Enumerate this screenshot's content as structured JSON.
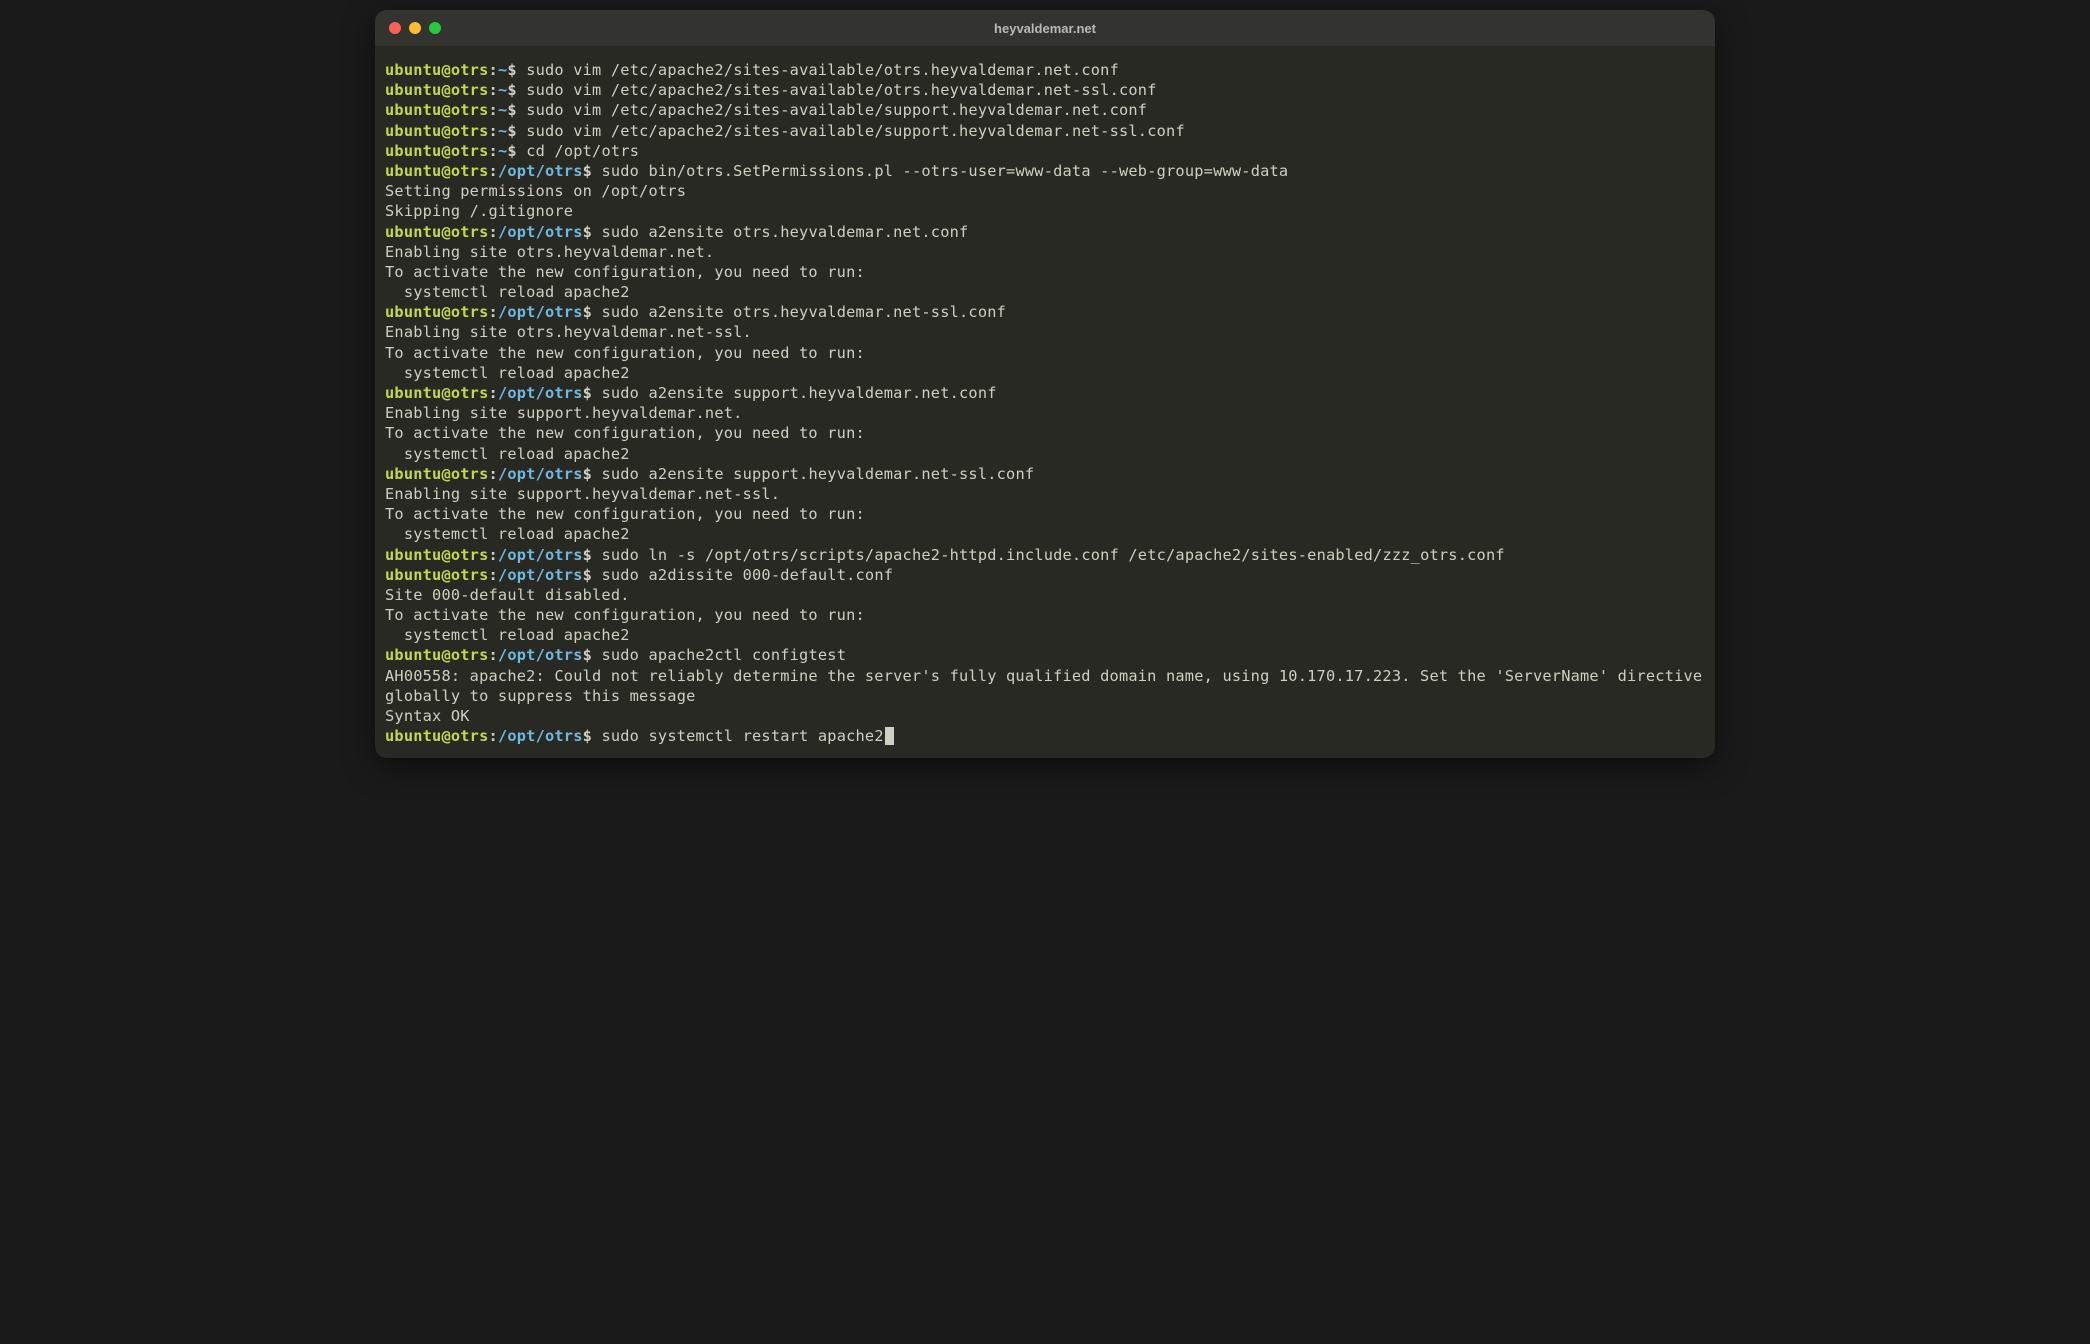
{
  "window": {
    "title": "heyvaldemar.net"
  },
  "colors": {
    "bg": "#282923",
    "titlebar": "#333430",
    "text": "#cfcfc2",
    "promptUser": "#c4d94a",
    "promptPath": "#6fb9e0",
    "red": "#ff5f56",
    "yellow": "#ffbd2e",
    "green": "#27c93f"
  },
  "lines": [
    {
      "type": "prompt",
      "user": "ubuntu@otrs",
      "path": "~",
      "cmd": "sudo vim /etc/apache2/sites-available/otrs.heyvaldemar.net.conf"
    },
    {
      "type": "prompt",
      "user": "ubuntu@otrs",
      "path": "~",
      "cmd": "sudo vim /etc/apache2/sites-available/otrs.heyvaldemar.net-ssl.conf"
    },
    {
      "type": "prompt",
      "user": "ubuntu@otrs",
      "path": "~",
      "cmd": "sudo vim /etc/apache2/sites-available/support.heyvaldemar.net.conf"
    },
    {
      "type": "prompt",
      "user": "ubuntu@otrs",
      "path": "~",
      "cmd": "sudo vim /etc/apache2/sites-available/support.heyvaldemar.net-ssl.conf"
    },
    {
      "type": "prompt",
      "user": "ubuntu@otrs",
      "path": "~",
      "cmd": "cd /opt/otrs"
    },
    {
      "type": "prompt",
      "user": "ubuntu@otrs",
      "path": "/opt/otrs",
      "cmd": "sudo bin/otrs.SetPermissions.pl --otrs-user=www-data --web-group=www-data"
    },
    {
      "type": "out",
      "text": "Setting permissions on /opt/otrs"
    },
    {
      "type": "out",
      "text": "Skipping /.gitignore"
    },
    {
      "type": "prompt",
      "user": "ubuntu@otrs",
      "path": "/opt/otrs",
      "cmd": "sudo a2ensite otrs.heyvaldemar.net.conf"
    },
    {
      "type": "out",
      "text": "Enabling site otrs.heyvaldemar.net."
    },
    {
      "type": "out",
      "text": "To activate the new configuration, you need to run:"
    },
    {
      "type": "out",
      "text": "  systemctl reload apache2"
    },
    {
      "type": "prompt",
      "user": "ubuntu@otrs",
      "path": "/opt/otrs",
      "cmd": "sudo a2ensite otrs.heyvaldemar.net-ssl.conf"
    },
    {
      "type": "out",
      "text": "Enabling site otrs.heyvaldemar.net-ssl."
    },
    {
      "type": "out",
      "text": "To activate the new configuration, you need to run:"
    },
    {
      "type": "out",
      "text": "  systemctl reload apache2"
    },
    {
      "type": "prompt",
      "user": "ubuntu@otrs",
      "path": "/opt/otrs",
      "cmd": "sudo a2ensite support.heyvaldemar.net.conf"
    },
    {
      "type": "out",
      "text": "Enabling site support.heyvaldemar.net."
    },
    {
      "type": "out",
      "text": "To activate the new configuration, you need to run:"
    },
    {
      "type": "out",
      "text": "  systemctl reload apache2"
    },
    {
      "type": "prompt",
      "user": "ubuntu@otrs",
      "path": "/opt/otrs",
      "cmd": "sudo a2ensite support.heyvaldemar.net-ssl.conf"
    },
    {
      "type": "out",
      "text": "Enabling site support.heyvaldemar.net-ssl."
    },
    {
      "type": "out",
      "text": "To activate the new configuration, you need to run:"
    },
    {
      "type": "out",
      "text": "  systemctl reload apache2"
    },
    {
      "type": "prompt",
      "user": "ubuntu@otrs",
      "path": "/opt/otrs",
      "cmd": "sudo ln -s /opt/otrs/scripts/apache2-httpd.include.conf /etc/apache2/sites-enabled/zzz_otrs.conf"
    },
    {
      "type": "prompt",
      "user": "ubuntu@otrs",
      "path": "/opt/otrs",
      "cmd": "sudo a2dissite 000-default.conf"
    },
    {
      "type": "out",
      "text": "Site 000-default disabled."
    },
    {
      "type": "out",
      "text": "To activate the new configuration, you need to run:"
    },
    {
      "type": "out",
      "text": "  systemctl reload apache2"
    },
    {
      "type": "prompt",
      "user": "ubuntu@otrs",
      "path": "/opt/otrs",
      "cmd": "sudo apache2ctl configtest"
    },
    {
      "type": "out",
      "text": "AH00558: apache2: Could not reliably determine the server's fully qualified domain name, using 10.170.17.223. Set the 'ServerName' directive globally to suppress this message"
    },
    {
      "type": "out",
      "text": "Syntax OK"
    },
    {
      "type": "prompt",
      "user": "ubuntu@otrs",
      "path": "/opt/otrs",
      "cmd": "sudo systemctl restart apache2",
      "cursor": true
    }
  ]
}
